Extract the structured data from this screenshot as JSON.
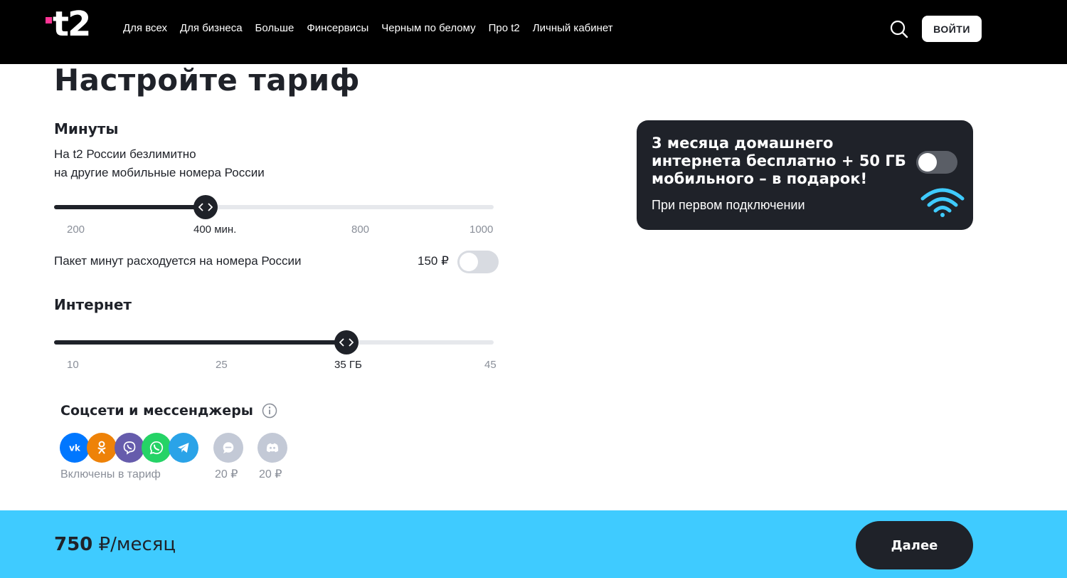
{
  "header": {
    "logo_text": "t2",
    "nav": [
      "Для всех",
      "Для бизнеса",
      "Больше",
      "Финсервисы",
      "Черным по белому",
      "Про t2",
      "Личный кабинет"
    ],
    "login_label": "ВОЙТИ"
  },
  "page_title": "Настройте тариф",
  "minutes": {
    "title": "Минуты",
    "desc_line1": "На t2 России безлимитно",
    "desc_line2": "на другие мобильные номера России",
    "ticks": [
      "200",
      "400 мин.",
      "800",
      "1000"
    ],
    "selected": "400 мин.",
    "slider_fraction": 0.345,
    "package_label": "Пакет минут расходуется на номера России",
    "package_price": "150 ₽",
    "package_enabled": false
  },
  "internet": {
    "title": "Интернет",
    "ticks": [
      "10",
      "25",
      "35 ГБ",
      "45"
    ],
    "selected": "35 ГБ",
    "slider_fraction": 0.665
  },
  "social": {
    "title": "Соцсети и мессенджеры",
    "included_icons": [
      "vk-icon",
      "odnoklassniki-icon",
      "viber-icon",
      "whatsapp-icon",
      "telegram-icon"
    ],
    "included_label": "Включены в тариф",
    "extras": [
      {
        "icon": "chat-bubble-icon",
        "price": "20 ₽"
      },
      {
        "icon": "discord-icon",
        "price": "20 ₽"
      }
    ]
  },
  "promo": {
    "title": "3 месяца домашнего интернета бесплатно + 50 ГБ мобильного – в подарок!",
    "subtitle": "При первом подключении",
    "enabled": false
  },
  "footer": {
    "price_amount": "750",
    "price_suffix": " ₽/месяц",
    "next_label": "Далее"
  },
  "colors": {
    "header_bg": "#000000",
    "accent_pink": "#ff3495",
    "dark": "#1f2229",
    "footer_bg": "#3fcbff",
    "track_bg": "#e6e8ec",
    "vk": "#0077ff",
    "ok": "#ee8208",
    "viber": "#665cac",
    "whatsapp": "#25d366",
    "telegram": "#2aa3e8",
    "extra_grey": "#c3c9d6"
  }
}
